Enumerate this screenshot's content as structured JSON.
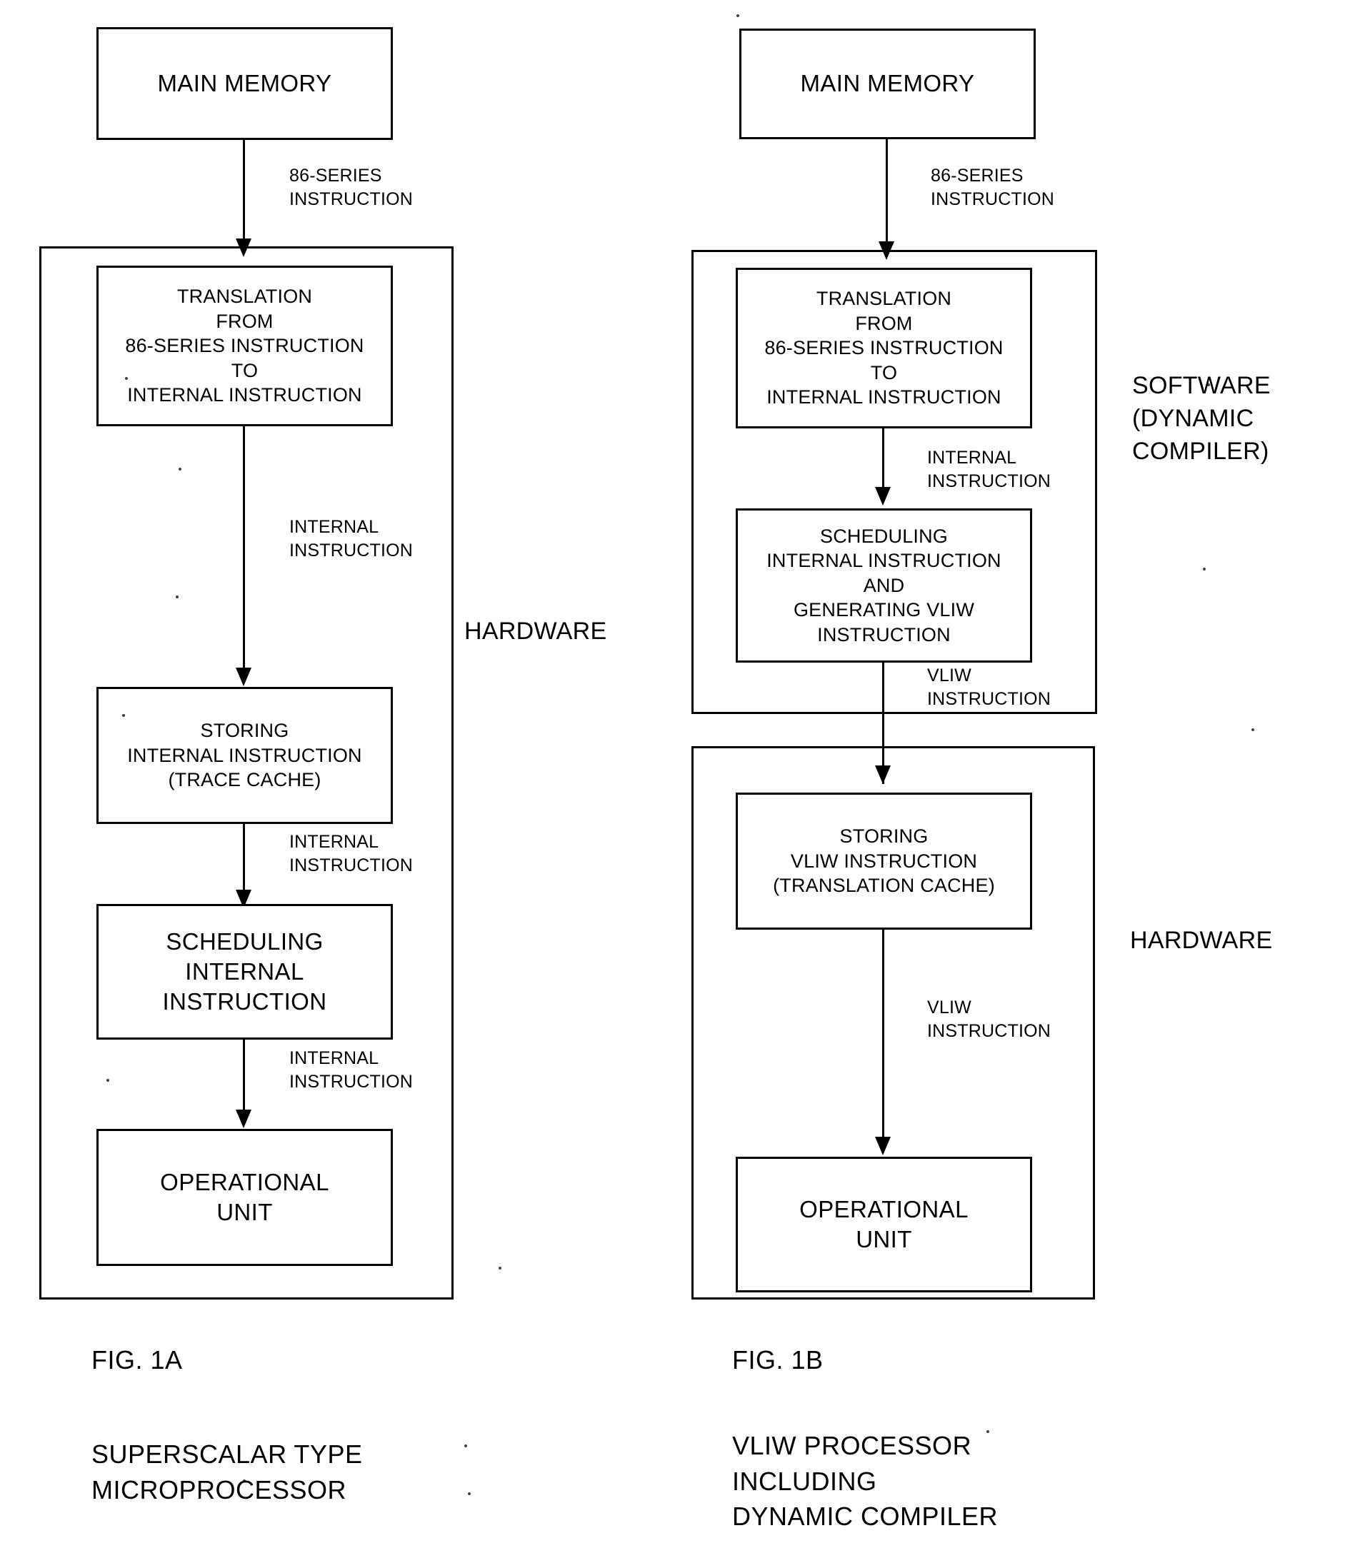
{
  "figures": [
    {
      "id": "fig-1a",
      "caption_label": "FIG. 1A",
      "caption_title_line1": "SUPERSCALAR TYPE",
      "caption_title_line2": "MICROPROCESSOR",
      "group_label": "HARDWARE",
      "memory_box": {
        "line1": "MAIN MEMORY"
      },
      "memory_arrow_label": {
        "line1": "86-SERIES",
        "line2": "INSTRUCTION"
      },
      "boxes": [
        {
          "name": "translation-box",
          "lines": [
            "TRANSLATION",
            "FROM",
            "86-SERIES INSTRUCTION",
            "TO",
            "INTERNAL INSTRUCTION"
          ]
        },
        {
          "name": "storing-box",
          "lines": [
            "STORING",
            "INTERNAL INSTRUCTION",
            "(TRACE CACHE)"
          ]
        },
        {
          "name": "scheduling-box",
          "lines": [
            "SCHEDULING",
            "INTERNAL",
            "INSTRUCTION"
          ]
        },
        {
          "name": "operational-unit-box",
          "lines": [
            "OPERATIONAL",
            "UNIT"
          ]
        }
      ],
      "arrow_labels": [
        {
          "name": "internal-instruction-1",
          "line1": "INTERNAL",
          "line2": "INSTRUCTION"
        },
        {
          "name": "internal-instruction-2",
          "line1": "INTERNAL",
          "line2": "INSTRUCTION"
        },
        {
          "name": "internal-instruction-3",
          "line1": "INTERNAL",
          "line2": "INSTRUCTION"
        }
      ]
    },
    {
      "id": "fig-1b",
      "caption_label": "FIG. 1B",
      "caption_title_line1": "VLIW PROCESSOR",
      "caption_title_line2": "INCLUDING",
      "caption_title_line3": "DYNAMIC COMPILER",
      "software_label_line1": "SOFTWARE",
      "software_label_line2": "(DYNAMIC",
      "software_label_line3": "COMPILER)",
      "hardware_label": "HARDWARE",
      "memory_box": {
        "line1": "MAIN MEMORY"
      },
      "memory_arrow_label": {
        "line1": "86-SERIES",
        "line2": "INSTRUCTION"
      },
      "boxes": [
        {
          "name": "translation-box",
          "lines": [
            "TRANSLATION",
            "FROM",
            "86-SERIES INSTRUCTION",
            "TO",
            "INTERNAL INSTRUCTION"
          ]
        },
        {
          "name": "scheduling-vliw-box",
          "lines": [
            "SCHEDULING",
            "INTERNAL INSTRUCTION",
            "AND",
            "GENERATING VLIW",
            "INSTRUCTION"
          ]
        },
        {
          "name": "storing-vliw-box",
          "lines": [
            "STORING",
            "VLIW INSTRUCTION",
            "(TRANSLATION CACHE)"
          ]
        },
        {
          "name": "operational-unit-box",
          "lines": [
            "OPERATIONAL",
            "UNIT"
          ]
        }
      ],
      "arrow_labels": [
        {
          "name": "internal-instruction-1",
          "line1": "INTERNAL",
          "line2": "INSTRUCTION"
        },
        {
          "name": "vliw-instruction-1",
          "line1": "VLIW",
          "line2": "INSTRUCTION"
        },
        {
          "name": "vliw-instruction-2",
          "line1": "VLIW",
          "line2": "INSTRUCTION"
        }
      ]
    }
  ],
  "colors": {
    "ink": "#000000",
    "paper": "#ffffff"
  }
}
